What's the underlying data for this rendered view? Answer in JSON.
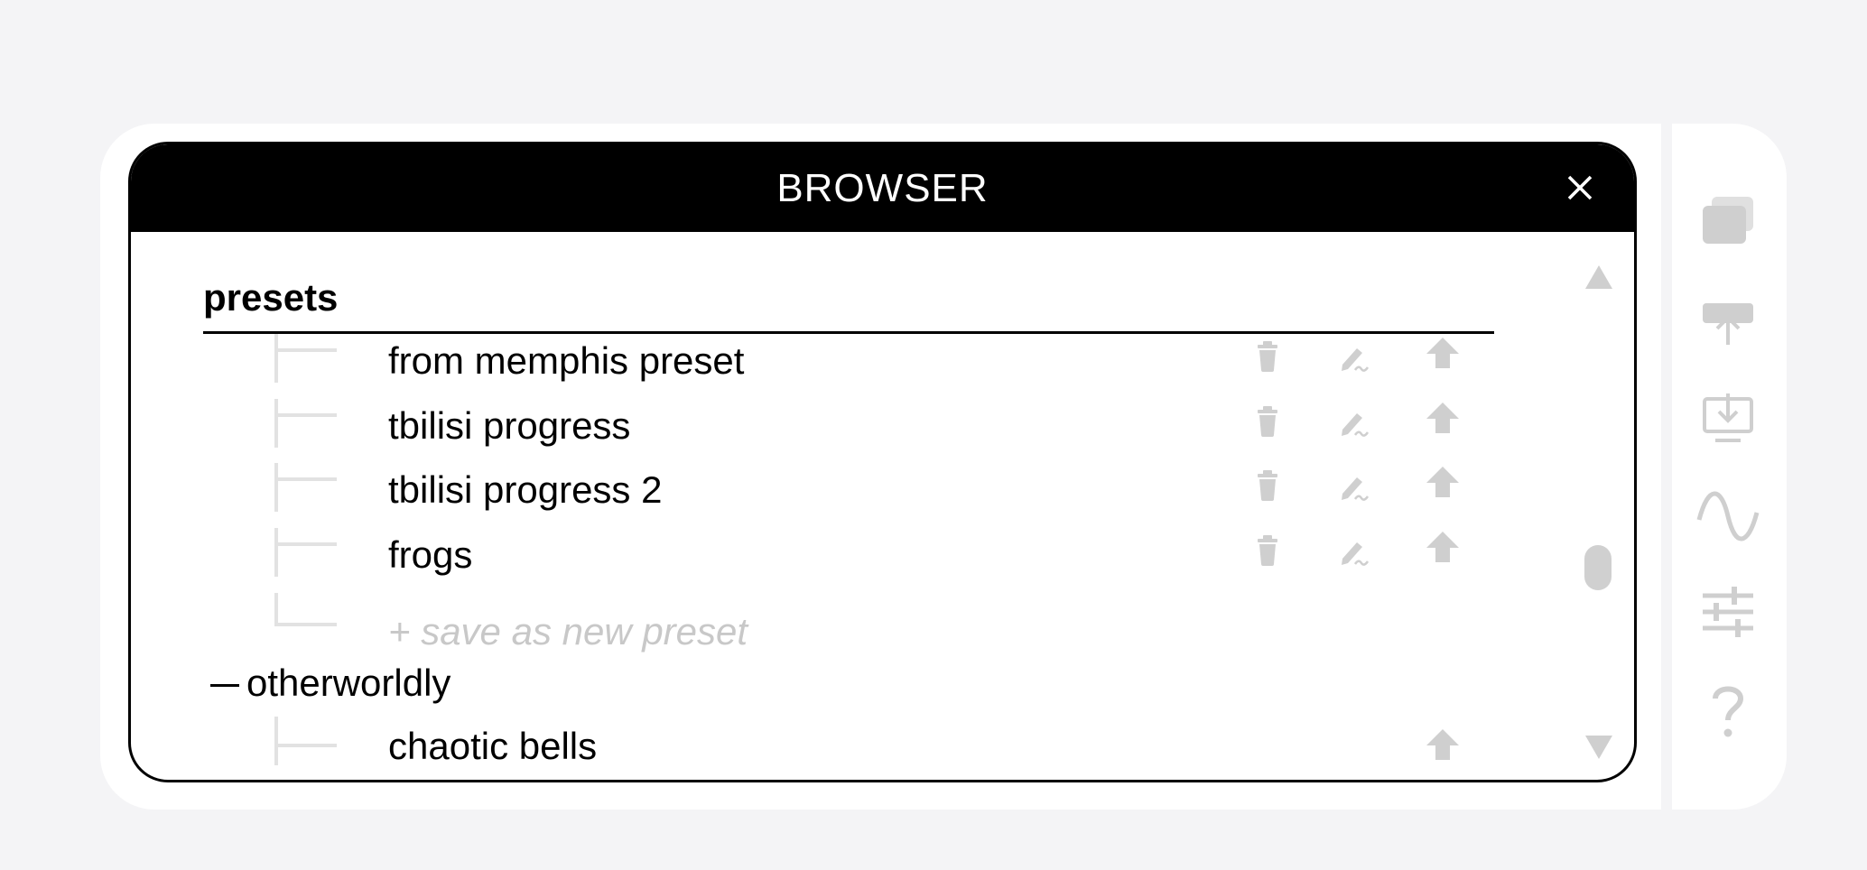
{
  "window": {
    "title": "BROWSER",
    "close_icon": "close-icon"
  },
  "section": {
    "title": "presets"
  },
  "presets": [
    {
      "label": "from memphis preset",
      "actions": [
        "trash-icon",
        "rename-icon",
        "upload-icon"
      ]
    },
    {
      "label": "tbilisi progress",
      "actions": [
        "trash-icon",
        "rename-icon",
        "upload-icon"
      ]
    },
    {
      "label": "tbilisi progress 2",
      "actions": [
        "trash-icon",
        "rename-icon",
        "upload-icon"
      ]
    },
    {
      "label": "frogs",
      "actions": [
        "trash-icon",
        "rename-icon",
        "upload-icon"
      ]
    }
  ],
  "save_new": {
    "label": "+ save as new preset"
  },
  "group": {
    "collapse_symbol": "—",
    "label": "otherworldly"
  },
  "group_items": [
    {
      "label": "chaotic bells",
      "actions": [
        "upload-icon"
      ]
    }
  ],
  "scrollbar": {
    "up_icon": "triangle-up-icon",
    "down_icon": "triangle-down-icon"
  },
  "sidebar": {
    "icons": [
      "windows-icon",
      "upload-to-device-icon",
      "download-to-computer-icon",
      "sine-wave-icon",
      "sliders-icon",
      "help-icon"
    ]
  },
  "colors": {
    "title_bar": "#000000",
    "icon_gray": "#cfcfcf",
    "placeholder": "#c8c8c8",
    "page_bg": "#f4f4f6"
  }
}
